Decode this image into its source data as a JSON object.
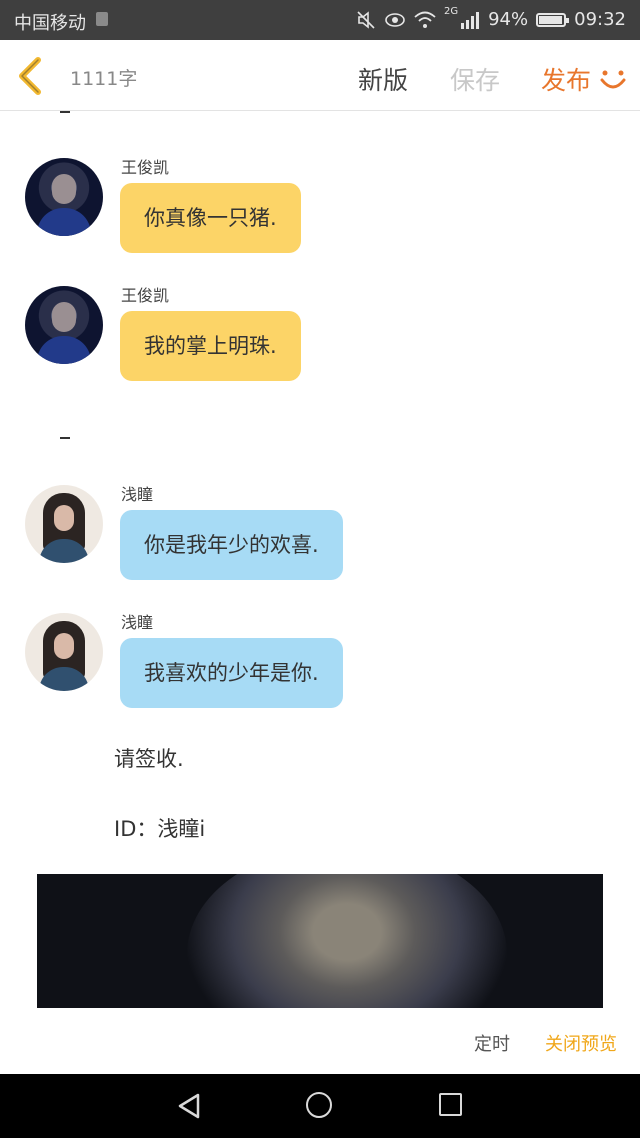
{
  "status_bar": {
    "carrier": "中国移动",
    "network": "2G",
    "battery": "94%",
    "battery_level": 0.94,
    "time": "09:32",
    "icons": [
      "mute-icon",
      "eye-icon",
      "wifi-icon",
      "signal-icon",
      "battery-icon"
    ]
  },
  "toolbar": {
    "word_count": "1111字",
    "new_version": "新版",
    "save": "保存",
    "publish": "发布",
    "colors": {
      "publish": "#e8762c",
      "save_disabled": "#c8c8c8"
    }
  },
  "messages": [
    {
      "sender": "王俊凯",
      "text": "你真像一只猪.",
      "bubble_color": "#fcd467"
    },
    {
      "sender": "王俊凯",
      "text": "我的掌上明珠.",
      "bubble_color": "#fcd467"
    },
    {
      "sender": "浅瞳",
      "text": "你是我年少的欢喜.",
      "bubble_color": "#a7dbf5"
    },
    {
      "sender": "浅瞳",
      "text": "我喜欢的少年是你.",
      "bubble_color": "#a7dbf5"
    }
  ],
  "plain_text": {
    "line1": "请签收.",
    "line2": "ID：浅瞳i"
  },
  "bottom_actions": {
    "schedule": "定时",
    "close_preview": "关闭预览",
    "accent": "#f0a71a"
  }
}
